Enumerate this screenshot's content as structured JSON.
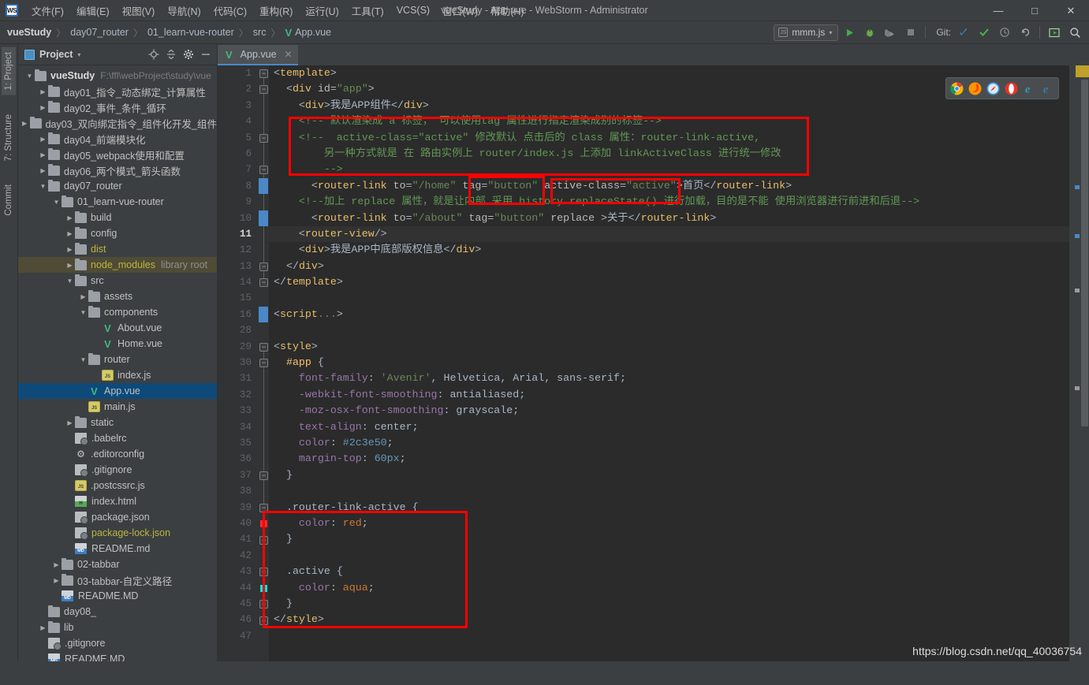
{
  "window": {
    "title": "vueStudy - App.vue - WebStorm - Administrator",
    "logo_text": "WS",
    "minimize": "—",
    "maximize": "□",
    "close": "✕"
  },
  "menu": [
    {
      "label": "文件(F)"
    },
    {
      "label": "编辑(E)"
    },
    {
      "label": "视图(V)"
    },
    {
      "label": "导航(N)"
    },
    {
      "label": "代码(C)"
    },
    {
      "label": "重构(R)"
    },
    {
      "label": "运行(U)"
    },
    {
      "label": "工具(T)"
    },
    {
      "label": "VCS(S)"
    },
    {
      "label": "窗口(W)"
    },
    {
      "label": "帮助(H)"
    }
  ],
  "breadcrumb": {
    "items": [
      "vueStudy",
      "day07_router",
      "01_learn-vue-router",
      "src",
      "App.vue"
    ],
    "separator": "〉",
    "file_icon": "vue-icon"
  },
  "toolbar": {
    "run_config": "mmm.js",
    "run_config_caret": "▾",
    "run_label": "run-icon",
    "debug_label": "debug-icon",
    "coverage_label": "coverage-icon",
    "stop_label": "stop-icon",
    "git_label": "Git:",
    "git_update": "update-icon",
    "git_commit": "commit-icon",
    "git_history": "history-icon",
    "git_rollback": "rollback-icon",
    "hide_label": "hide-icon",
    "search_label": "search-icon"
  },
  "left_strip": [
    {
      "label": "1: Project",
      "active": true
    },
    {
      "label": "7: Structure",
      "active": false
    },
    {
      "label": "Commit",
      "active": false
    }
  ],
  "project_panel": {
    "title": "Project",
    "caret": "▾",
    "actions": [
      "locate-icon",
      "collapse-all-icon",
      "settings-icon",
      "hide-icon"
    ]
  },
  "tree": [
    {
      "depth": 0,
      "arrow": "▼",
      "icon": "folder",
      "label": "vueStudy",
      "bold": true,
      "hint": "F:\\ffl\\webProject\\study\\vue"
    },
    {
      "depth": 1,
      "arrow": "▶",
      "icon": "folder",
      "label": "day01_指令_动态绑定_计算属性"
    },
    {
      "depth": 1,
      "arrow": "▶",
      "icon": "folder",
      "label": "day02_事件_条件_循环"
    },
    {
      "depth": 1,
      "arrow": "▶",
      "icon": "folder",
      "label": "day03_双向绑定指令_组件化开发_组件"
    },
    {
      "depth": 1,
      "arrow": "▶",
      "icon": "folder",
      "label": "day04_前端模块化"
    },
    {
      "depth": 1,
      "arrow": "▶",
      "icon": "folder",
      "label": "day05_webpack使用和配置"
    },
    {
      "depth": 1,
      "arrow": "▶",
      "icon": "folder",
      "label": "day06_两个模式_箭头函数"
    },
    {
      "depth": 1,
      "arrow": "▼",
      "icon": "folder",
      "label": "day07_router"
    },
    {
      "depth": 2,
      "arrow": "▼",
      "icon": "folder",
      "label": "01_learn-vue-router"
    },
    {
      "depth": 3,
      "arrow": "▶",
      "icon": "folder",
      "label": "build"
    },
    {
      "depth": 3,
      "arrow": "▶",
      "icon": "folder",
      "label": "config"
    },
    {
      "depth": 3,
      "arrow": "▶",
      "icon": "folder",
      "label": "dist",
      "color": "yellow"
    },
    {
      "depth": 3,
      "arrow": "▶",
      "icon": "folder",
      "label": "node_modules",
      "color": "yellow",
      "hint2": "library root",
      "highlight": true
    },
    {
      "depth": 3,
      "arrow": "▼",
      "icon": "folder",
      "label": "src"
    },
    {
      "depth": 4,
      "arrow": "▶",
      "icon": "folder",
      "label": "assets"
    },
    {
      "depth": 4,
      "arrow": "▼",
      "icon": "folder",
      "label": "components"
    },
    {
      "depth": 5,
      "arrow": "",
      "icon": "vue",
      "label": "About.vue"
    },
    {
      "depth": 5,
      "arrow": "",
      "icon": "vue",
      "label": "Home.vue"
    },
    {
      "depth": 4,
      "arrow": "▼",
      "icon": "folder",
      "label": "router"
    },
    {
      "depth": 5,
      "arrow": "",
      "icon": "js",
      "label": "index.js"
    },
    {
      "depth": 4,
      "arrow": "",
      "icon": "vue",
      "label": "App.vue",
      "selected": true
    },
    {
      "depth": 4,
      "arrow": "",
      "icon": "js",
      "label": "main.js"
    },
    {
      "depth": 3,
      "arrow": "▶",
      "icon": "folder",
      "label": "static"
    },
    {
      "depth": 3,
      "arrow": "",
      "icon": "doc",
      "label": ".babelrc"
    },
    {
      "depth": 3,
      "arrow": "",
      "icon": "gear",
      "label": ".editorconfig"
    },
    {
      "depth": 3,
      "arrow": "",
      "icon": "doc",
      "label": ".gitignore"
    },
    {
      "depth": 3,
      "arrow": "",
      "icon": "js",
      "label": ".postcssrc.js"
    },
    {
      "depth": 3,
      "arrow": "",
      "icon": "html",
      "label": "index.html"
    },
    {
      "depth": 3,
      "arrow": "",
      "icon": "doc",
      "label": "package.json"
    },
    {
      "depth": 3,
      "arrow": "",
      "icon": "doc",
      "label": "package-lock.json",
      "color": "yellow"
    },
    {
      "depth": 3,
      "arrow": "",
      "icon": "md",
      "label": "README.md"
    },
    {
      "depth": 2,
      "arrow": "▶",
      "icon": "folder",
      "label": "02-tabbar"
    },
    {
      "depth": 2,
      "arrow": "▶",
      "icon": "folder",
      "label": "03-tabbar-自定义路径"
    },
    {
      "depth": 2,
      "arrow": "",
      "icon": "md",
      "label": "README.MD"
    },
    {
      "depth": 1,
      "arrow": "",
      "icon": "folder",
      "label": "day08_"
    },
    {
      "depth": 1,
      "arrow": "▶",
      "icon": "folder",
      "label": "lib"
    },
    {
      "depth": 1,
      "arrow": "",
      "icon": "doc",
      "label": ".gitignore"
    },
    {
      "depth": 1,
      "arrow": "",
      "icon": "md",
      "label": "README.MD"
    }
  ],
  "editor": {
    "tab": {
      "label": "App.vue",
      "close": "✕",
      "icon": "vue-icon"
    },
    "current_line": 11,
    "line_numbers": [
      1,
      2,
      3,
      4,
      5,
      6,
      7,
      8,
      9,
      10,
      11,
      12,
      13,
      14,
      15,
      16,
      28,
      29,
      30,
      31,
      32,
      33,
      34,
      35,
      36,
      37,
      38,
      39,
      40,
      41,
      42,
      43,
      44,
      45,
      46,
      47
    ],
    "lines": [
      {
        "n": 1,
        "html": "<span class='punct'>&lt;</span><span class='tag'>template</span><span class='punct'>&gt;</span>"
      },
      {
        "n": 2,
        "html": "  <span class='punct'>&lt;</span><span class='tag'>div</span> <span class='attr'>id</span><span class='punct'>=</span><span class='str'>\"app\"</span><span class='punct'>&gt;</span>"
      },
      {
        "n": 3,
        "html": "    <span class='punct'>&lt;</span><span class='tag'>div</span><span class='punct'>&gt;</span><span class='txt'>我是APP组件</span><span class='punct'>&lt;/</span><span class='tag'>div</span><span class='punct'>&gt;</span>"
      },
      {
        "n": 4,
        "html": "    <span class='cmt'>&lt;!-- 默认渲染成 a 标签， 可以使用tag 属性进行指定渲染成别的标签--&gt;</span>"
      },
      {
        "n": 5,
        "html": "    <span class='cmt'>&lt;!--  active-class=\"active\" 修改默认 点击后的 class 属性：router-link-active,</span>"
      },
      {
        "n": 6,
        "html": "        <span class='cmt'>另一种方式就是 在 路由实例上 router/index.js 上添加 linkActiveClass 进行统一修改</span>"
      },
      {
        "n": 7,
        "html": "        <span class='cmt'>--&gt;</span>"
      },
      {
        "n": 8,
        "html": "      <span class='punct'>&lt;</span><span class='tag'>router-link</span> <span class='attr'>to</span><span class='punct'>=</span><span class='str'>\"/home\"</span> <span class='attr'>tag</span><span class='punct'>=</span><span class='str'>\"button\"</span> <span class='attr'>active-class</span><span class='punct'>=</span><span class='str'>\"active\"</span><span class='punct'>&gt;</span><span class='txt'>首页</span><span class='punct'>&lt;/</span><span class='tag'>router-link</span><span class='punct'>&gt;</span>"
      },
      {
        "n": 9,
        "html": "    <span class='cmt'>&lt;!--加上 replace 属性，就是让内部 采用 history.replaceState() 进行加载，目的是不能 使用浏览器进行前进和后退--&gt;</span>"
      },
      {
        "n": 10,
        "html": "      <span class='punct'>&lt;</span><span class='tag'>router-link</span> <span class='attr'>to</span><span class='punct'>=</span><span class='str'>\"/about\"</span> <span class='attr'>tag</span><span class='punct'>=</span><span class='str'>\"button\"</span> <span class='attr'>replace</span> <span class='punct'>&gt;</span><span class='txt'>关于</span><span class='punct'>&lt;/</span><span class='tag'>router-link</span><span class='punct'>&gt;</span>"
      },
      {
        "n": 11,
        "html": "    <span class='punct'>&lt;</span><span class='tag'>router-view</span><span class='punct'>/&gt;</span>",
        "current": true
      },
      {
        "n": 12,
        "html": "    <span class='punct'>&lt;</span><span class='tag'>div</span><span class='punct'>&gt;</span><span class='txt'>我是APP中底部版权信息</span><span class='punct'>&lt;/</span><span class='tag'>div</span><span class='punct'>&gt;</span>"
      },
      {
        "n": 13,
        "html": "  <span class='punct'>&lt;/</span><span class='tag'>div</span><span class='punct'>&gt;</span>"
      },
      {
        "n": 14,
        "html": "<span class='punct'>&lt;/</span><span class='tag'>template</span><span class='punct'>&gt;</span>"
      },
      {
        "n": 15,
        "html": ""
      },
      {
        "n": 16,
        "html": "<span class='punct'>&lt;</span><span class='tag'>script</span><span class='fade'>...</span><span class='punct'>&gt;</span>"
      },
      {
        "n": 28,
        "html": ""
      },
      {
        "n": 29,
        "html": "<span class='punct'>&lt;</span><span class='tag'>style</span><span class='punct'>&gt;</span>"
      },
      {
        "n": 30,
        "html": "  <span class='sel-css'>#app</span> <span class='punct'>{</span>"
      },
      {
        "n": 31,
        "html": "    <span class='prop'>font-family</span><span class='punct'>:</span> <span class='str'>'Avenir'</span><span class='punct'>,</span> <span class='cssval'>Helvetica</span><span class='punct'>,</span> <span class='cssval'>Arial</span><span class='punct'>,</span> <span class='cssval'>sans-serif</span><span class='punct'>;</span>"
      },
      {
        "n": 32,
        "html": "    <span class='prop'>-webkit-font-smoothing</span><span class='punct'>:</span> <span class='cssval'>antialiased</span><span class='punct'>;</span>"
      },
      {
        "n": 33,
        "html": "    <span class='prop'>-moz-osx-font-smoothing</span><span class='punct'>:</span> <span class='cssval'>grayscale</span><span class='punct'>;</span>"
      },
      {
        "n": 34,
        "html": "    <span class='prop'>text-align</span><span class='punct'>:</span> <span class='cssval'>center</span><span class='punct'>;</span>"
      },
      {
        "n": 35,
        "html": "    <span class='prop'>color</span><span class='punct'>:</span> <span class='num'>#2c3e50</span><span class='punct'>;</span>"
      },
      {
        "n": 36,
        "html": "    <span class='prop'>margin-top</span><span class='punct'>:</span> <span class='num'>60px</span><span class='punct'>;</span>"
      },
      {
        "n": 37,
        "html": "  <span class='punct'>}</span>"
      },
      {
        "n": 38,
        "html": ""
      },
      {
        "n": 39,
        "html": "  <span class='sel-css' style='color:#a9b7c6'>.router-link-active</span> <span class='punct'>{</span>"
      },
      {
        "n": 40,
        "html": "    <span class='prop'>color</span><span class='punct'>:</span> <span class='cssval' style='color:#cc7832'>red</span><span class='punct'>;</span>"
      },
      {
        "n": 41,
        "html": "  <span class='punct'>}</span>"
      },
      {
        "n": 42,
        "html": ""
      },
      {
        "n": 43,
        "html": "  <span class='sel-css' style='color:#a9b7c6'>.active</span> <span class='punct'>{</span>"
      },
      {
        "n": 44,
        "html": "    <span class='prop'>color</span><span class='punct'>:</span> <span class='cssval' style='color:#cc7832'>aqua</span><span class='punct'>;</span>"
      },
      {
        "n": 45,
        "html": "  <span class='punct'>}</span>"
      },
      {
        "n": 46,
        "html": "<span class='punct'>&lt;/</span><span class='tag'>style</span><span class='punct'>&gt;</span>"
      },
      {
        "n": 47,
        "html": ""
      }
    ]
  },
  "browsers": [
    {
      "name": "chrome-icon",
      "color": "#4caf50"
    },
    {
      "name": "firefox-icon",
      "color": "#ff7139"
    },
    {
      "name": "safari-icon",
      "color": "#3f9de0"
    },
    {
      "name": "opera-icon",
      "color": "#e63329"
    },
    {
      "name": "ie-icon",
      "color": "#1ebbee"
    },
    {
      "name": "edge-icon",
      "color": "#2d8fd4"
    }
  ],
  "annotations": {
    "box_comment": "comment-block-highlight",
    "box_tag": "tag-attribute-highlight",
    "box_active_class": "active-class-attribute-highlight",
    "box_css": "router-link-active-css-highlight",
    "accent_red": "#ff0000"
  },
  "watermark": "https://blog.csdn.net/qq_40036754"
}
